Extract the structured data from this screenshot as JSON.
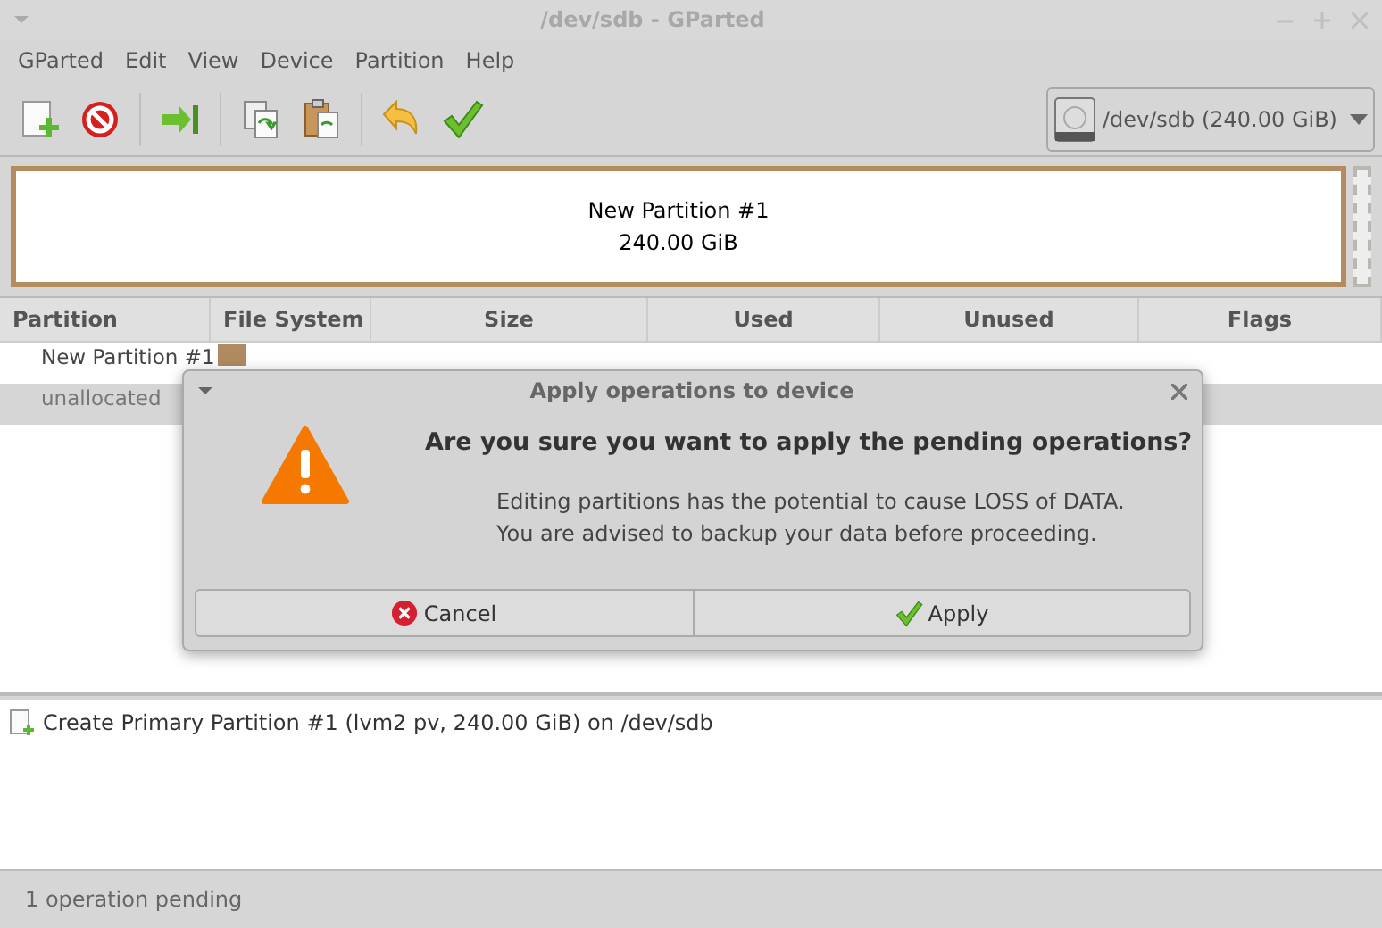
{
  "window": {
    "title": "/dev/sdb - GParted"
  },
  "menu": [
    "GParted",
    "Edit",
    "View",
    "Device",
    "Partition",
    "Help"
  ],
  "device_selector": {
    "value": "/dev/sdb (240.00 GiB)"
  },
  "disk_map": {
    "partition_name": "New Partition #1",
    "partition_size": "240.00 GiB"
  },
  "table": {
    "columns": [
      "Partition",
      "File System",
      "Size",
      "Used",
      "Unused",
      "Flags"
    ],
    "rows": [
      {
        "partition": "New Partition #1",
        "color": "#b08a60",
        "selected": false
      },
      {
        "partition": "unallocated",
        "selected": true
      }
    ]
  },
  "dialog": {
    "title": "Apply operations to device",
    "heading": "Are you sure you want to apply the pending operations?",
    "message": [
      "Editing partitions has the potential to cause LOSS of DATA.",
      "You are advised to backup your data before proceeding."
    ],
    "buttons": [
      {
        "kind": "cancel",
        "label": "Cancel"
      },
      {
        "kind": "apply",
        "label": "Apply"
      }
    ]
  },
  "operations": [
    "Create Primary Partition #1 (lvm2 pv, 240.00 GiB) on /dev/sdb"
  ],
  "status_bar": "1 operation pending"
}
